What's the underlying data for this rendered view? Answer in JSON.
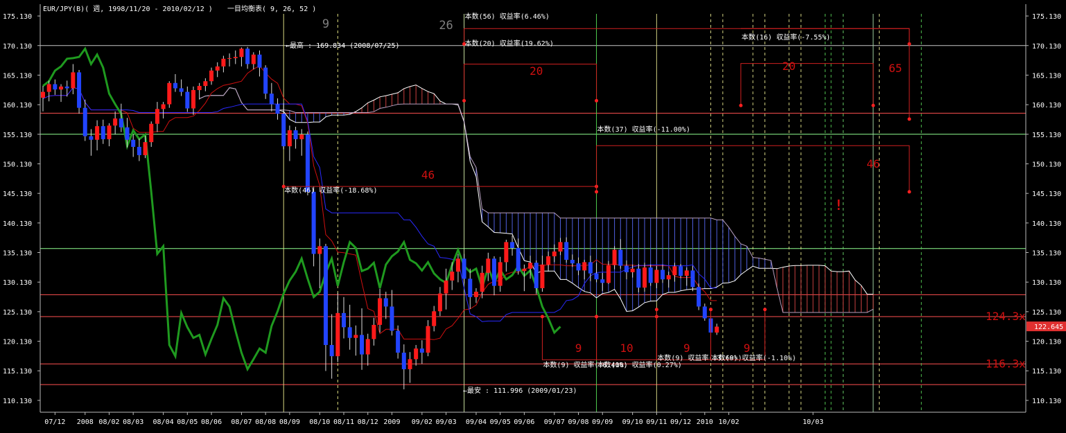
{
  "header": {
    "title": "EUR/JPY(B)( 週, 1998/11/20 - 2010/02/12 )",
    "indicator": "一目均衡表( 9, 26, 52 )"
  },
  "chart_data": {
    "type": "candlestick",
    "timeframe": "weekly",
    "ylim": [
      108.13,
      177.13
    ],
    "y_ticks": [
      "175.130",
      "170.130",
      "165.130",
      "160.130",
      "155.130",
      "150.130",
      "145.130",
      "140.130",
      "135.130",
      "130.130",
      "125.130",
      "120.130",
      "115.130",
      "110.130"
    ],
    "x_ticks": [
      "07/12",
      "2008",
      "08/02",
      "08/03",
      "08/04",
      "08/05",
      "08/06",
      "08/07",
      "08/08",
      "08/09",
      "08/10",
      "08/11",
      "08/12",
      "2009",
      "09/02",
      "09/03",
      "09/04",
      "09/05",
      "09/06",
      "09/07",
      "09/08",
      "09/09",
      "09/10",
      "09/11",
      "09/12",
      "2010",
      "10/02",
      "10/03"
    ],
    "x_tick_idx": [
      2,
      7,
      11,
      15,
      20,
      24,
      28,
      33,
      37,
      41,
      46,
      50,
      54,
      58,
      63,
      67,
      72,
      76,
      80,
      85,
      89,
      93,
      98,
      102,
      106,
      110,
      114,
      128
    ],
    "current_price": "122.645",
    "candles": [
      [
        161.3,
        163.3,
        159.0,
        162.3
      ],
      [
        162.3,
        164.2,
        160.7,
        163.6
      ],
      [
        163.6,
        164.4,
        161.8,
        162.7
      ],
      [
        162.7,
        163.6,
        160.6,
        163.2
      ],
      [
        163.2,
        164.2,
        161.5,
        162.9
      ],
      [
        162.9,
        167.0,
        161.9,
        165.6
      ],
      [
        165.6,
        166.0,
        158.6,
        159.6
      ],
      [
        159.6,
        161.0,
        154.0,
        154.8
      ],
      [
        154.8,
        156.0,
        151.5,
        154.2
      ],
      [
        154.2,
        157.5,
        152.4,
        156.5
      ],
      [
        156.5,
        157.6,
        153.5,
        154.3
      ],
      [
        154.3,
        157.0,
        153.1,
        156.6
      ],
      [
        156.6,
        159.0,
        155.1,
        157.8
      ],
      [
        157.8,
        160.3,
        155.5,
        156.3
      ],
      [
        156.3,
        157.9,
        152.9,
        154.2
      ],
      [
        154.2,
        155.1,
        151.3,
        153.0
      ],
      [
        153.0,
        154.4,
        150.6,
        151.6
      ],
      [
        151.6,
        154.9,
        151.1,
        153.8
      ],
      [
        153.8,
        157.3,
        153.0,
        156.9
      ],
      [
        156.9,
        160.6,
        155.5,
        159.4
      ],
      [
        159.4,
        160.6,
        157.8,
        160.2
      ],
      [
        160.2,
        164.1,
        159.6,
        163.8
      ],
      [
        163.8,
        165.3,
        162.3,
        162.9
      ],
      [
        162.9,
        164.4,
        161.6,
        162.3
      ],
      [
        162.3,
        163.2,
        158.9,
        159.5
      ],
      [
        159.5,
        163.2,
        158.4,
        162.6
      ],
      [
        162.6,
        163.8,
        161.0,
        163.3
      ],
      [
        163.3,
        164.6,
        162.4,
        164.1
      ],
      [
        164.1,
        166.4,
        163.5,
        165.9
      ],
      [
        165.9,
        167.3,
        164.8,
        166.6
      ],
      [
        166.6,
        168.4,
        165.6,
        167.9
      ],
      [
        167.9,
        168.8,
        166.6,
        168.0
      ],
      [
        168.0,
        169.3,
        167.0,
        168.2
      ],
      [
        168.2,
        169.8,
        166.6,
        169.6
      ],
      [
        169.6,
        169.9,
        166.2,
        167.0
      ],
      [
        167.0,
        169.0,
        166.1,
        168.6
      ],
      [
        168.6,
        169.3,
        164.9,
        166.4
      ],
      [
        166.4,
        166.8,
        161.1,
        162.0
      ],
      [
        162.0,
        163.8,
        159.0,
        160.2
      ],
      [
        160.2,
        161.2,
        157.6,
        158.6
      ],
      [
        158.6,
        160.4,
        152.6,
        153.1
      ],
      [
        153.1,
        156.6,
        150.6,
        155.8
      ],
      [
        155.8,
        156.4,
        152.7,
        154.3
      ],
      [
        154.3,
        156.0,
        151.5,
        155.1
      ],
      [
        155.1,
        155.6,
        144.8,
        145.4
      ],
      [
        145.4,
        146.3,
        132.8,
        134.9
      ],
      [
        134.9,
        137.5,
        129.1,
        136.2
      ],
      [
        136.2,
        136.6,
        115.1,
        119.5
      ],
      [
        119.5,
        124.7,
        113.8,
        117.6
      ],
      [
        117.6,
        128.3,
        116.6,
        124.9
      ],
      [
        124.9,
        127.6,
        120.6,
        122.5
      ],
      [
        122.5,
        126.3,
        118.7,
        120.7
      ],
      [
        120.7,
        122.8,
        117.7,
        121.2
      ],
      [
        121.2,
        125.7,
        115.3,
        117.9
      ],
      [
        117.9,
        121.4,
        116.0,
        120.5
      ],
      [
        120.5,
        124.1,
        119.4,
        122.9
      ],
      [
        122.9,
        129.0,
        121.6,
        127.4
      ],
      [
        127.4,
        128.5,
        123.9,
        126.0
      ],
      [
        126.0,
        128.8,
        121.1,
        121.9
      ],
      [
        121.9,
        122.8,
        117.2,
        118.2
      ],
      [
        118.2,
        119.6,
        112.0,
        115.4
      ],
      [
        115.4,
        118.3,
        113.1,
        117.1
      ],
      [
        117.1,
        119.5,
        116.0,
        118.9
      ],
      [
        118.9,
        120.3,
        116.3,
        118.2
      ],
      [
        118.2,
        123.7,
        117.6,
        122.7
      ],
      [
        122.7,
        126.1,
        121.8,
        125.2
      ],
      [
        125.2,
        129.3,
        124.4,
        128.2
      ],
      [
        128.2,
        132.4,
        125.5,
        130.4
      ],
      [
        130.4,
        133.5,
        128.8,
        131.9
      ],
      [
        131.9,
        134.9,
        130.1,
        134.1
      ],
      [
        134.1,
        134.9,
        129.9,
        130.7
      ],
      [
        130.7,
        132.4,
        125.6,
        127.6
      ],
      [
        127.6,
        129.1,
        126.6,
        128.5
      ],
      [
        128.5,
        132.9,
        127.4,
        131.7
      ],
      [
        131.7,
        135.1,
        130.3,
        134.1
      ],
      [
        134.1,
        134.5,
        127.9,
        129.5
      ],
      [
        129.5,
        134.4,
        128.5,
        133.5
      ],
      [
        133.5,
        137.3,
        131.9,
        136.9
      ],
      [
        136.9,
        138.0,
        134.6,
        135.9
      ],
      [
        135.9,
        137.5,
        131.4,
        132.0
      ],
      [
        132.0,
        133.1,
        128.6,
        132.4
      ],
      [
        132.4,
        134.6,
        130.7,
        133.4
      ],
      [
        133.4,
        133.8,
        128.1,
        129.1
      ],
      [
        129.1,
        134.6,
        128.5,
        133.1
      ],
      [
        133.1,
        135.3,
        131.9,
        134.5
      ],
      [
        134.5,
        136.5,
        133.5,
        135.3
      ],
      [
        135.3,
        137.6,
        134.7,
        136.9
      ],
      [
        136.9,
        137.7,
        133.4,
        133.9
      ],
      [
        133.9,
        134.8,
        132.7,
        133.3
      ],
      [
        133.3,
        134.3,
        131.3,
        132.1
      ],
      [
        132.1,
        133.9,
        130.6,
        133.5
      ],
      [
        133.5,
        134.6,
        130.3,
        131.6
      ],
      [
        131.6,
        133.4,
        130.1,
        130.6
      ],
      [
        130.6,
        131.7,
        128.6,
        130.0
      ],
      [
        130.0,
        133.7,
        129.8,
        133.0
      ],
      [
        133.0,
        136.2,
        132.3,
        135.6
      ],
      [
        135.6,
        137.4,
        132.4,
        132.9
      ],
      [
        132.9,
        133.8,
        130.6,
        131.8
      ],
      [
        131.8,
        133.1,
        130.9,
        132.4
      ],
      [
        132.4,
        133.2,
        128.4,
        129.2
      ],
      [
        129.2,
        133.4,
        128.5,
        132.6
      ],
      [
        132.6,
        133.1,
        129.5,
        130.0
      ],
      [
        130.0,
        132.9,
        129.1,
        132.2
      ],
      [
        132.2,
        133.1,
        130.0,
        130.6
      ],
      [
        130.6,
        131.9,
        129.2,
        131.3
      ],
      [
        131.3,
        133.4,
        130.2,
        132.8
      ],
      [
        132.8,
        133.2,
        130.8,
        131.2
      ],
      [
        131.2,
        132.6,
        129.5,
        132.1
      ],
      [
        132.1,
        132.9,
        128.6,
        129.3
      ],
      [
        129.3,
        129.9,
        125.4,
        126.0
      ],
      [
        126.0,
        126.5,
        123.6,
        124.0
      ],
      [
        124.0,
        124.5,
        120.6,
        121.6
      ],
      [
        121.6,
        123.1,
        121.2,
        122.6
      ]
    ],
    "stats_boxes": [
      {
        "label": "本数(56) 収益率(6.46%)",
        "span_label": "26"
      },
      {
        "label": "本数(20) 収益率(19.62%)",
        "span_label": "20"
      },
      {
        "label": "本数(46) 収益率(-18.68%)",
        "span_label": "46"
      },
      {
        "label": "本数(37) 収益率(-11.00%)",
        "span_label": "46"
      },
      {
        "label": "本数(16) 収益率(-7.55%)",
        "span_label": "20"
      },
      {
        "label": "本数(9) 収益率(-6.40%)",
        "span_label": "9"
      },
      {
        "label": "本数(10) 収益率(0.27%)",
        "span_label": "10"
      },
      {
        "label": "本数(9) 収益率(-3.60%)",
        "span_label": "9"
      },
      {
        "label": "本数(9) 収益率(-1.10%)",
        "span_label": "9"
      }
    ],
    "big_labels": [
      "9",
      "26",
      "65"
    ],
    "annotations": {
      "high": "←最高 : 169.834 (2008/07/25)",
      "low": "←最安 : 111.996 (2009/01/23)",
      "exclaim": "!"
    },
    "hlines": [
      {
        "y": 170.13,
        "color": "#c8c8c8"
      },
      {
        "y": 158.7,
        "color": "#ff5050"
      },
      {
        "y": 155.13,
        "color": "#90ff90"
      },
      {
        "y": 135.8,
        "color": "#90ff90"
      },
      {
        "y": 128.0,
        "color": "#ff5050"
      },
      {
        "y": 124.3,
        "color": "#ff5050",
        "label": "124.3x"
      },
      {
        "y": 116.3,
        "color": "#ff5050",
        "label": "116.3x"
      },
      {
        "y": 112.8,
        "color": "#ff5050"
      }
    ],
    "colors": {
      "up": "#ff1a1a",
      "down": "#2244ff",
      "chikou": "#1f9a1f",
      "tenkan": "#d01010",
      "kijun": "#2a2aff",
      "span_a": "#ffffff",
      "span_b": "#b8a0c0",
      "cloud_red": "#c84040",
      "cloud_blue": "#5060e0",
      "text": "#ffffff",
      "label_red": "#d01010"
    }
  }
}
